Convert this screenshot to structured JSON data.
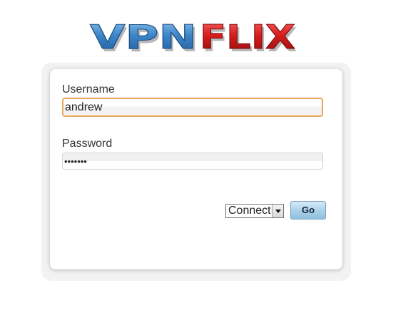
{
  "logo": {
    "text_primary": "VPN",
    "text_secondary": "Flix",
    "primary_color": "#3a7fc0",
    "secondary_color": "#d42020"
  },
  "login": {
    "username_label": "Username",
    "username_value": "andrew",
    "password_label": "Password",
    "password_masked": "•••••••",
    "mode_select_value": "Connect",
    "go_label": "Go"
  },
  "colors": {
    "focus_border": "#e8a95c",
    "button_blue": "#a9cfe9"
  }
}
